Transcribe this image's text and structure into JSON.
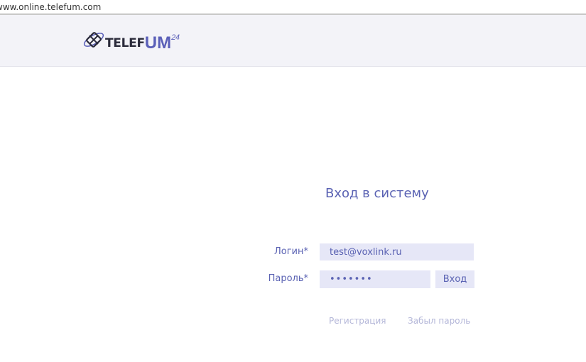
{
  "browser": {
    "url": "www.online.telefum.com"
  },
  "header": {
    "logo": {
      "prefix": "Telef",
      "highlight": "UM",
      "superscript": "24",
      "icon": "satellite-phone-icon"
    }
  },
  "login": {
    "title": "Вход в систему",
    "login_label": "Логин*",
    "login_value": "test@voxlink.ru",
    "password_label": "Пароль*",
    "password_value": "•••••••",
    "submit_label": "Вход",
    "register_link": "Регистрация",
    "forgot_link": "Забыл пароль"
  },
  "colors": {
    "accent": "#5a62b3",
    "input_bg": "#e6e7f7",
    "link_muted": "#b3b6d8",
    "header_bg": "#f3f3f8"
  }
}
